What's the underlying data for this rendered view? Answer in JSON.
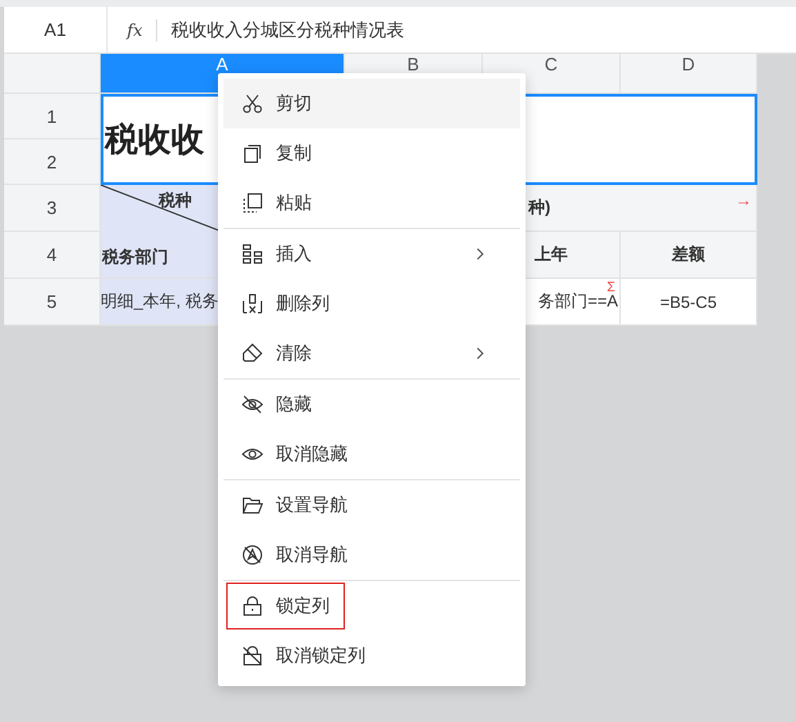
{
  "formula_bar": {
    "cell_ref": "A1",
    "fx": "fx",
    "content": "税收收入分城区分税种情况表"
  },
  "columns": [
    {
      "label": "A",
      "selected": true
    },
    {
      "label": "B",
      "selected": false
    },
    {
      "label": "C",
      "selected": false
    },
    {
      "label": "D",
      "selected": false
    }
  ],
  "rows": [
    "1",
    "2",
    "3",
    "4",
    "5"
  ],
  "sheet": {
    "title": "税收收",
    "diagonal_top": "税种",
    "diagonal_bottom": "税务部门",
    "row3_header": "种)",
    "row3_marker": "→",
    "c4": "上年",
    "d4": "差额",
    "a5": "明细_本年, 税务",
    "c5": "务部门==A",
    "c5_marker": "Σ",
    "d5": "=B5-C5"
  },
  "context_menu": {
    "items": [
      {
        "kind": "item",
        "label": "剪切",
        "hovered": true,
        "submenu": false,
        "outlined": false
      },
      {
        "kind": "item",
        "label": "复制",
        "hovered": false,
        "submenu": false,
        "outlined": false
      },
      {
        "kind": "item",
        "label": "粘贴",
        "hovered": false,
        "submenu": false,
        "outlined": false
      },
      {
        "kind": "divider"
      },
      {
        "kind": "item",
        "label": "插入",
        "hovered": false,
        "submenu": true,
        "outlined": false
      },
      {
        "kind": "item",
        "label": "删除列",
        "hovered": false,
        "submenu": false,
        "outlined": false
      },
      {
        "kind": "item",
        "label": "清除",
        "hovered": false,
        "submenu": true,
        "outlined": false
      },
      {
        "kind": "divider"
      },
      {
        "kind": "item",
        "label": "隐藏",
        "hovered": false,
        "submenu": false,
        "outlined": false
      },
      {
        "kind": "item",
        "label": "取消隐藏",
        "hovered": false,
        "submenu": false,
        "outlined": false
      },
      {
        "kind": "divider"
      },
      {
        "kind": "item",
        "label": "设置导航",
        "hovered": false,
        "submenu": false,
        "outlined": false
      },
      {
        "kind": "item",
        "label": "取消导航",
        "hovered": false,
        "submenu": false,
        "outlined": false
      },
      {
        "kind": "divider"
      },
      {
        "kind": "item",
        "label": "锁定列",
        "hovered": false,
        "submenu": false,
        "outlined": true
      },
      {
        "kind": "item",
        "label": "取消锁定列",
        "hovered": false,
        "submenu": false,
        "outlined": false
      }
    ]
  }
}
